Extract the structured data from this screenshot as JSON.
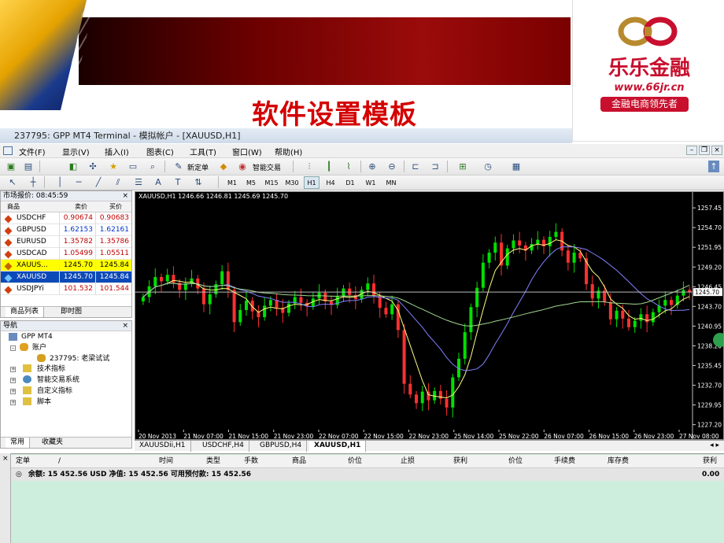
{
  "banner": {
    "title": "软件设置模板",
    "logo_name": "乐乐金融",
    "logo_url": "www.66jr.cn",
    "logo_slogan": "金融电商领先者"
  },
  "window": {
    "title": "237795: GPP MT4 Terminal - 模拟帐户 - [XAUUSD,H1]",
    "menu": [
      "文件(F)",
      "显示(V)",
      "插入(I)",
      "图表(C)",
      "工具(T)",
      "窗口(W)",
      "帮助(H)"
    ],
    "toolbar1": {
      "new_order": "新定单",
      "expert": "智能交易"
    },
    "timeframes": [
      "M1",
      "M5",
      "M15",
      "M30",
      "H1",
      "H4",
      "D1",
      "W1",
      "MN"
    ],
    "selected_timeframe": "H1"
  },
  "market_watch": {
    "title": "市场报价: 08:45:59",
    "cols": {
      "symbol": "商品",
      "bid": "卖价",
      "ask": "买价"
    },
    "rows": [
      {
        "symbol": "USDCHF",
        "bid": "0.90674",
        "ask": "0.90683",
        "color": "#c00000"
      },
      {
        "symbol": "GBPUSD",
        "bid": "1.62153",
        "ask": "1.62161",
        "color": "#0033cc"
      },
      {
        "symbol": "EURUSD",
        "bid": "1.35782",
        "ask": "1.35786",
        "color": "#c00000"
      },
      {
        "symbol": "USDCAD",
        "bid": "1.05499",
        "ask": "1.05511",
        "color": "#c00000"
      },
      {
        "symbol": "XAUUS...",
        "bid": "1245.70",
        "ask": "1245.84",
        "color": "#000000"
      },
      {
        "symbol": "XAUUSD",
        "bid": "1245.70",
        "ask": "1245.84",
        "color": "#ffffff"
      },
      {
        "symbol": "USDJPYi",
        "bid": "101.532",
        "ask": "101.544",
        "color": "#c00000"
      }
    ],
    "tabs": [
      "商品列表",
      "即时图"
    ]
  },
  "navigator": {
    "title": "导航",
    "root": "GPP MT4",
    "accounts": "账户",
    "account": "237795: 老梁试试",
    "indicators": "技术指标",
    "experts": "智能交易系统",
    "custom": "自定义指标",
    "scripts": "脚本",
    "tabs": [
      "常用",
      "收藏夹"
    ]
  },
  "chart": {
    "header": "XAUUSD,H1  1246.66 1246.81 1245.69 1245.70",
    "price_label": "1245.70",
    "tabs": [
      "XAUUSDii,H1",
      "USDCHF,H4",
      "GBPUSD,H4",
      "XAUUSD,H1"
    ]
  },
  "chart_data": {
    "type": "candlestick",
    "symbol": "XAUUSD",
    "timeframe": "H1",
    "y_ticks": [
      "1257.45",
      "1254.70",
      "1251.95",
      "1249.20",
      "1246.45",
      "1243.70",
      "1240.95",
      "1238.20",
      "1235.45",
      "1232.70",
      "1229.95",
      "1227.20"
    ],
    "x_ticks": [
      "20 Nov 2013",
      "21 Nov 07:00",
      "21 Nov 15:00",
      "21 Nov 23:00",
      "22 Nov 07:00",
      "22 Nov 15:00",
      "22 Nov 23:00",
      "25 Nov 14:00",
      "25 Nov 22:00",
      "26 Nov 07:00",
      "26 Nov 15:00",
      "26 Nov 23:00",
      "27 Nov 08:00"
    ],
    "ylim": [
      1226.5,
      1259.0
    ],
    "current_price": 1245.7,
    "close": [
      1245.0,
      1246.5,
      1247.8,
      1247.2,
      1248.1,
      1247.0,
      1246.0,
      1246.9,
      1247.6,
      1246.2,
      1244.0,
      1245.4,
      1246.8,
      1248.6,
      1246.0,
      1241.5,
      1243.2,
      1244.5,
      1243.0,
      1242.2,
      1243.8,
      1244.6,
      1243.5,
      1242.8,
      1244.1,
      1245.0,
      1244.2,
      1243.7,
      1244.8,
      1245.6,
      1244.4,
      1243.9,
      1245.1,
      1246.2,
      1245.3,
      1244.7,
      1246.0,
      1246.9,
      1245.2,
      1243.5,
      1242.6,
      1244.0,
      1240.4,
      1232.9,
      1231.4,
      1230.2,
      1231.8,
      1230.6,
      1231.9,
      1230.8,
      1229.6,
      1233.8,
      1236.4,
      1240.1,
      1243.6,
      1246.3,
      1249.8,
      1251.2,
      1252.6,
      1249.4,
      1251.8,
      1252.9,
      1252.2,
      1251.5,
      1252.4,
      1253.0,
      1252.1,
      1253.4,
      1254.1,
      1251.5,
      1249.8,
      1251.2,
      1250.4,
      1246.8,
      1244.8,
      1245.9,
      1244.3,
      1241.9,
      1243.1,
      1242.0,
      1240.8,
      1241.7,
      1242.6,
      1241.5,
      1242.9,
      1243.8,
      1244.6,
      1243.9,
      1245.2,
      1246.0,
      1245.7
    ],
    "series": [
      {
        "name": "MA fast",
        "color": "#ffff80"
      },
      {
        "name": "MA medium",
        "color": "#8080ff"
      },
      {
        "name": "MA slow",
        "color": "#a0d890"
      }
    ]
  },
  "terminal": {
    "cols": [
      "定单",
      "时间",
      "类型",
      "手数",
      "商品",
      "价位",
      "止损",
      "获利",
      "价位",
      "手续费",
      "库存费",
      "获利"
    ],
    "balance": "余额: 15 452.56 USD  净值: 15 452.56  可用预付款: 15 452.56",
    "total": "0.00"
  }
}
